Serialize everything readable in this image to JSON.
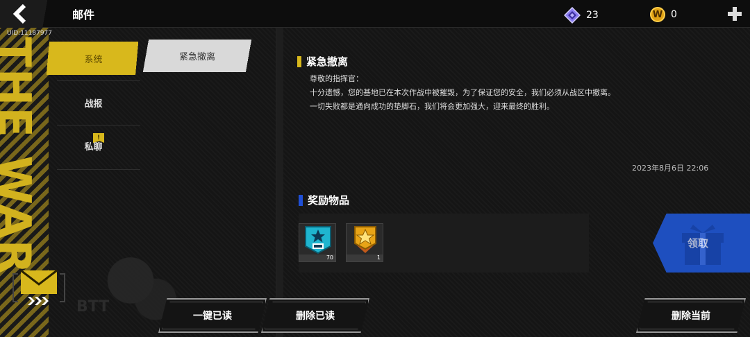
{
  "header": {
    "title": "邮件",
    "uid": "UID:11187977",
    "gems": "23",
    "coins": "0",
    "coin_symbol": "W"
  },
  "background": {
    "side_text": "THE WAR",
    "fist_text": "BTT"
  },
  "categories": [
    {
      "label": "系统",
      "active": true,
      "badge": ""
    },
    {
      "label": "战报",
      "active": false,
      "badge": ""
    },
    {
      "label": "私聊",
      "active": false,
      "badge": "!"
    }
  ],
  "mail_list": [
    {
      "title": "紧急撤离",
      "selected": true
    }
  ],
  "mail": {
    "title": "紧急撤离",
    "lines": [
      "尊敬的指挥官：",
      "十分遗憾，您的基地已在本次作战中被摧毁，为了保证您的安全，我们必须从战区中撤离。",
      "一切失败都是通向成功的垫脚石，我们将会更加强大，迎来最终的胜利。"
    ],
    "date": "2023年8月6日  22:06"
  },
  "rewards": {
    "title": "奖励物品",
    "items": [
      {
        "icon": "cyan-star-badge-icon",
        "qty": "70"
      },
      {
        "icon": "gold-star-medal-icon",
        "qty": "1"
      }
    ],
    "claim_label": "领取"
  },
  "buttons": {
    "read_all": "一键已读",
    "delete_read": "删除已读",
    "delete_current": "删除当前"
  },
  "colors": {
    "accent_yellow": "#d8b81c",
    "claim_blue": "#1e4fbf",
    "reward_title_bar": "#1f4fd6"
  }
}
